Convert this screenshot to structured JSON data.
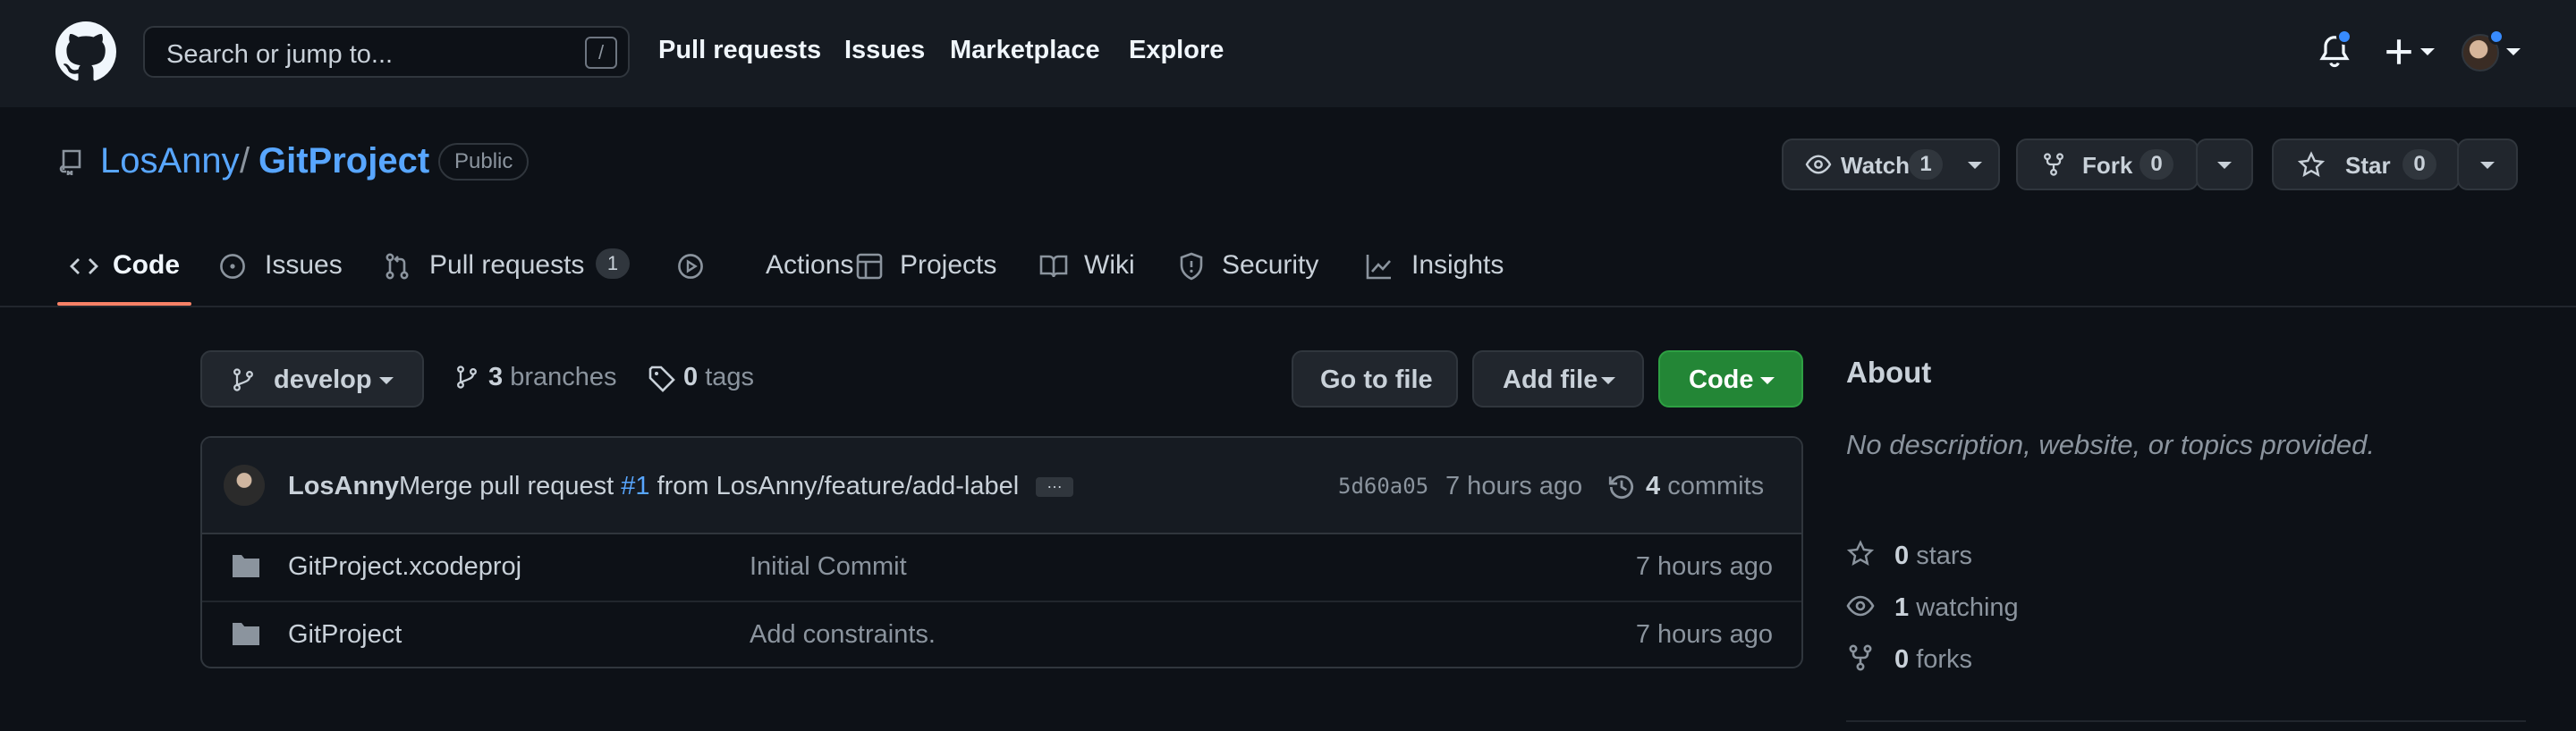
{
  "topbar": {
    "search_placeholder": "Search or jump to...",
    "search_shortcut": "/",
    "nav": [
      "Pull requests",
      "Issues",
      "Marketplace",
      "Explore"
    ]
  },
  "repo": {
    "owner": "LosAnny",
    "separator": "/",
    "name": "GitProject",
    "visibility": "Public",
    "watch": {
      "label": "Watch",
      "count": "1"
    },
    "fork": {
      "label": "Fork",
      "count": "0"
    },
    "star": {
      "label": "Star",
      "count": "0"
    }
  },
  "tabs": [
    {
      "label": "Code",
      "icon": "code-icon",
      "active": true
    },
    {
      "label": "Issues",
      "icon": "issue-icon"
    },
    {
      "label": "Pull requests",
      "icon": "pull-request-icon",
      "count": "1"
    },
    {
      "label": "Actions",
      "icon": "play-icon"
    },
    {
      "label": "Projects",
      "icon": "table-icon"
    },
    {
      "label": "Wiki",
      "icon": "book-icon"
    },
    {
      "label": "Security",
      "icon": "shield-icon"
    },
    {
      "label": "Insights",
      "icon": "graph-icon"
    }
  ],
  "toolbar": {
    "branch": "develop",
    "branches_count": "3",
    "branches_label": "branches",
    "tags_count": "0",
    "tags_label": "tags",
    "go_to_file": "Go to file",
    "add_file": "Add file",
    "code": "Code"
  },
  "commit": {
    "author": "LosAnny",
    "message_prefix": "Merge pull request",
    "pr_link": "#1",
    "message_suffix": "from LosAnny/feature/add-label",
    "ellipsis": "…",
    "hash": "5d60a05",
    "time": "7 hours ago",
    "commits_count": "4",
    "commits_label": "commits"
  },
  "files": [
    {
      "name": "GitProject.xcodeproj",
      "message": "Initial Commit",
      "time": "7 hours ago"
    },
    {
      "name": "GitProject",
      "message": "Add constraints.",
      "time": "7 hours ago"
    }
  ],
  "about": {
    "title": "About",
    "description": "No description, website, or topics provided.",
    "stars_count": "0",
    "stars_label": "stars",
    "watching_count": "1",
    "watching_label": "watching",
    "forks_count": "0",
    "forks_label": "forks"
  },
  "colors": {
    "background": "#0d1117",
    "header": "#161b22",
    "link": "#58a6ff",
    "accent_underline": "#f78166",
    "code_button": "#238636",
    "notification_dot": "#388bfd"
  }
}
